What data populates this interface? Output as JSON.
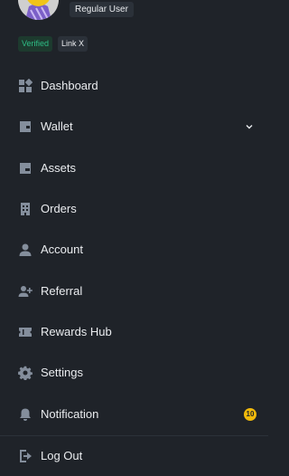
{
  "profile": {
    "user_type": "Regular User",
    "badges": {
      "verified": "Verified",
      "link": "Link X"
    }
  },
  "menu": {
    "dashboard": {
      "label": "Dashboard",
      "icon": "dashboard-icon"
    },
    "wallet": {
      "label": "Wallet",
      "icon": "wallet-icon",
      "expandable": true
    },
    "assets": {
      "label": "Assets",
      "icon": "assets-icon"
    },
    "orders": {
      "label": "Orders",
      "icon": "orders-icon"
    },
    "account": {
      "label": "Account",
      "icon": "account-icon"
    },
    "referral": {
      "label": "Referral",
      "icon": "referral-icon"
    },
    "rewards_hub": {
      "label": "Rewards Hub",
      "icon": "ticket-icon"
    },
    "settings": {
      "label": "Settings",
      "icon": "gear-icon"
    },
    "notification": {
      "label": "Notification",
      "icon": "bell-icon",
      "count": "10"
    },
    "logout": {
      "label": "Log Out",
      "icon": "logout-icon"
    }
  },
  "colors": {
    "background": "#1f2329",
    "text": "#eaecef",
    "icon": "#848e9c",
    "accent": "#f0b90b",
    "verified": "#2ebd85"
  }
}
